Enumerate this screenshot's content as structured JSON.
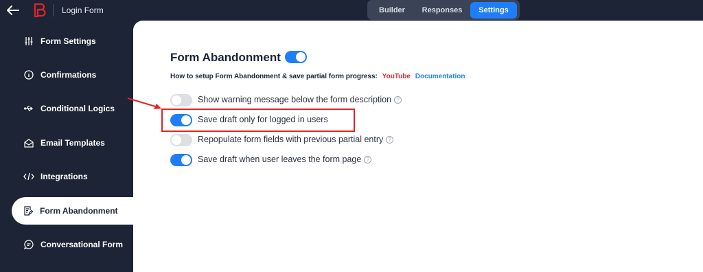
{
  "header": {
    "back_icon": "arrow-left-icon",
    "logo_icon": "brand-logo-icon",
    "title": "Login Form",
    "tabs": [
      {
        "label": "Builder"
      },
      {
        "label": "Responses"
      },
      {
        "label": "Settings"
      }
    ],
    "active_tab_color": "#1f7ef7"
  },
  "sidebar": {
    "items": [
      {
        "label": "Form Settings",
        "icon": "sliders-icon"
      },
      {
        "label": "Confirmations",
        "icon": "info-icon"
      },
      {
        "label": "Conditional Logics",
        "icon": "usb-icon"
      },
      {
        "label": "Email Templates",
        "icon": "envelope-open-icon"
      },
      {
        "label": "Integrations",
        "icon": "code-icon"
      },
      {
        "label": "Form Abandonment",
        "icon": "document-edit-icon"
      },
      {
        "label": "Conversational Form",
        "icon": "chat-icon"
      }
    ],
    "active_index": 5
  },
  "main": {
    "section_title": "Form Abandonment",
    "section_toggle_on": true,
    "help_text": "How to setup Form Abandonment & save partial form progress:",
    "youtube_link": "YouTube",
    "documentation_link": "Documentation",
    "options": [
      {
        "label": "Show warning message below the form description",
        "on": false,
        "has_help": true
      },
      {
        "label": "Save draft only for logged in users",
        "on": true,
        "has_help": false
      },
      {
        "label": "Repopulate form fields with previous partial entry",
        "on": false,
        "has_help": true
      },
      {
        "label": "Save draft when user leaves the form page",
        "on": true,
        "has_help": true
      }
    ]
  },
  "colors": {
    "sidebar_bg": "#1c2435",
    "accent": "#1f7ef7",
    "highlight": "#e0242a",
    "toggle_off": "#dcdfe4"
  }
}
